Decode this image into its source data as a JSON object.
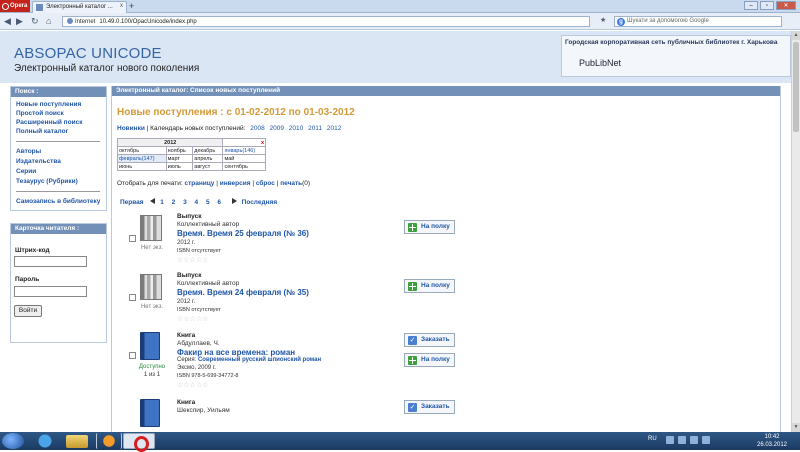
{
  "browser": {
    "menu_label": "Opera",
    "tab_title": "Электронный каталог ...",
    "tab_close": "x",
    "new_tab": "+",
    "address_protocol": "Internet",
    "address_url": "10.49.0.100/OpacUnicode/index.php",
    "search_placeholder": "Шукати за допомогою Google",
    "search_engine_letter": "g"
  },
  "header": {
    "title": "ABSOPAC UNICODE",
    "subtitle": "Электронный каталог нового поколения",
    "org": "Городская корпоративная сеть публичных библиотек г. Харькова",
    "network": "PubLibNet"
  },
  "search_panel": {
    "heading": "Поиск :",
    "links": [
      "Новые поступления",
      "Простой поиск",
      "Расширенный поиск",
      "Полный каталог"
    ],
    "links2": [
      "Авторы",
      "Издательства",
      "Серии",
      "Тезаурус (Рубрики)"
    ],
    "signup": "Самозапись в библиотеку"
  },
  "reader_panel": {
    "heading": "Карточка читателя :",
    "barcode_label": "Штрих-код",
    "password_label": "Пароль",
    "login_button": "Войти"
  },
  "main": {
    "heading": "Электронный каталог: Список новых поступлений",
    "title": "Новые поступления : с 01-02-2012 по 01-03-2012",
    "new_link": "Новинки",
    "calendar_text": "| Календарь новых поступлений:",
    "years": [
      "2008",
      "2009",
      "2010",
      "2011",
      "2012"
    ],
    "calendar": {
      "year": "2012",
      "close": "x",
      "rows": [
        [
          "октябрь",
          "ноябрь",
          "декабрь",
          "январь(146)"
        ],
        [
          "февраль(147)",
          "март",
          "апрель",
          "май"
        ],
        [
          "июнь",
          "июль",
          "август",
          "сентябрь"
        ]
      ]
    },
    "print_label": "Отобрать для печати:",
    "print_links": [
      "страницу",
      "инверсия",
      "сброс",
      "печать"
    ],
    "print_count": "(0)",
    "pager": {
      "first": "Первая",
      "pages": [
        "1",
        "2",
        "3",
        "4",
        "5",
        "6"
      ],
      "last": "Последняя"
    },
    "items": [
      {
        "type": "Выпуск",
        "author": "Коллективный автор",
        "title": "Время. Время 25 февраля (№ 36)",
        "year": "2012 г.",
        "isbn": "ISBN отсутствует",
        "availability": "Нет экз.",
        "action": "На полку",
        "stars": "☆☆☆☆☆"
      },
      {
        "type": "Выпуск",
        "author": "Коллективный автор",
        "title": "Время. Время 24 февраля (№ 35)",
        "year": "2012 г.",
        "isbn": "ISBN отсутствует",
        "availability": "Нет экз.",
        "action": "На полку",
        "stars": "☆☆☆☆☆"
      },
      {
        "type": "Книга",
        "author": "Абдуллаев, Ч.",
        "title": "Факир на все времена: роман",
        "series_label": "Серия:",
        "series": "Современный русский шпионский роман",
        "year": "Эксмо, 2009 г.",
        "isbn": "ISBN 978-5-699-34772-8",
        "availability": "Доступно",
        "availability2": "1 из 1",
        "action_order": "Заказать",
        "action": "На полку",
        "stars": "☆☆☆☆☆"
      },
      {
        "type": "Книга",
        "author": "Шекспир, Уильям",
        "action_order": "Заказать"
      }
    ]
  },
  "taskbar": {
    "lang": "RU",
    "time": "10:42",
    "date": "26.03.2012"
  },
  "colors": {
    "accent": "#3465a4",
    "header_bg": "#dae6f4",
    "panel_header": "#7390b8",
    "title_orange": "#d39a3a",
    "link": "#1f56a8"
  }
}
